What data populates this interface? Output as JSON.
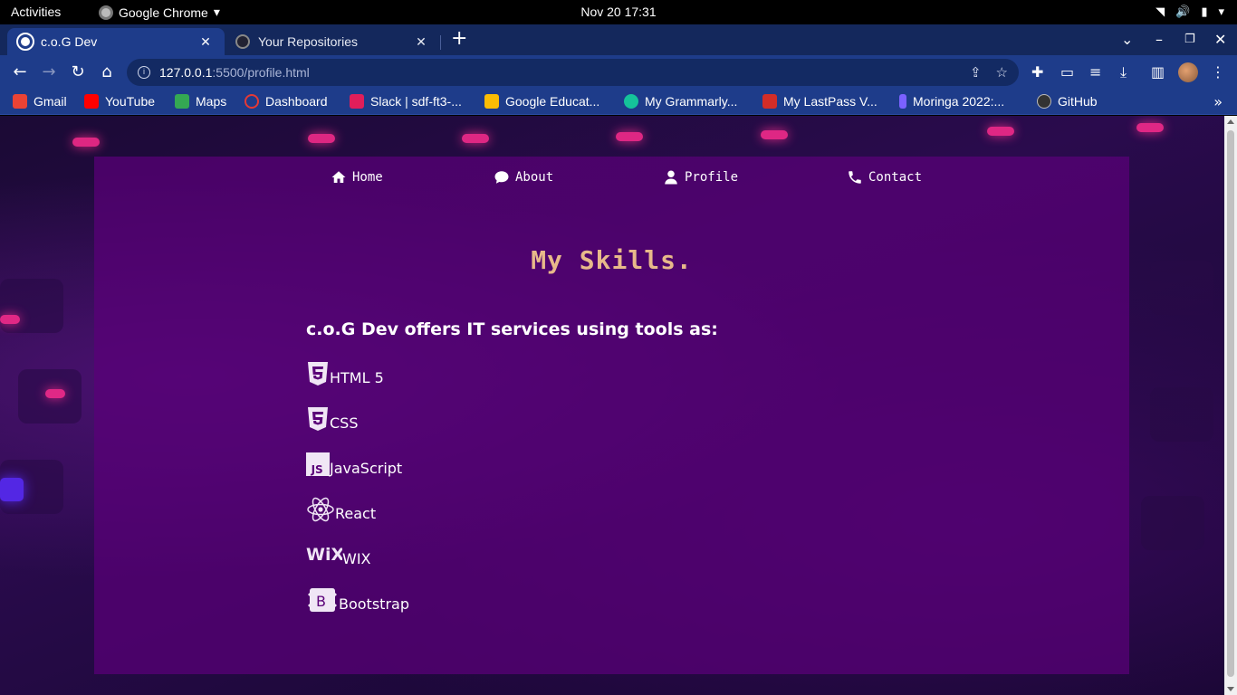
{
  "system": {
    "activities": "Activities",
    "app_name": "Google Chrome",
    "clock": "Nov 20  17:31"
  },
  "tabs": [
    {
      "title": "c.o.G Dev",
      "active": true
    },
    {
      "title": "Your Repositories",
      "active": false
    }
  ],
  "toolbar": {
    "url_host": "127.0.0.1",
    "url_path": ":5500/profile.html"
  },
  "bookmarks": [
    {
      "label": "Gmail",
      "color": "#ea4335"
    },
    {
      "label": "YouTube",
      "color": "#ff0000"
    },
    {
      "label": "Maps",
      "color": "#34a853"
    },
    {
      "label": "Dashboard",
      "color": "#e53935"
    },
    {
      "label": "Slack | sdf-ft3-...",
      "color": "#e01e5a"
    },
    {
      "label": "Google Educat...",
      "color": "#fbbc04"
    },
    {
      "label": "My Grammarly...",
      "color": "#15c39a"
    },
    {
      "label": "My LastPass V...",
      "color": "#d32d27"
    },
    {
      "label": "Moringa 2022:...",
      "color": "#7b61ff"
    },
    {
      "label": "GitHub",
      "color": "#333333"
    }
  ],
  "page": {
    "nav": [
      {
        "label": "Home",
        "icon": "home-icon"
      },
      {
        "label": "About",
        "icon": "comment-icon"
      },
      {
        "label": "Profile",
        "icon": "user-icon"
      },
      {
        "label": "Contact",
        "icon": "phone-icon"
      }
    ],
    "title": "My Skills.",
    "intro": "c.o.G Dev offers IT services using tools as:",
    "skills": [
      {
        "label": "HTML 5",
        "icon": "html5-icon"
      },
      {
        "label": "CSS",
        "icon": "css3-icon"
      },
      {
        "label": "JavaScript",
        "icon": "javascript-icon"
      },
      {
        "label": "React",
        "icon": "react-icon"
      },
      {
        "label": "WIX",
        "icon": "wix-icon"
      },
      {
        "label": "Bootstrap",
        "icon": "bootstrap-icon"
      }
    ]
  },
  "colors": {
    "title": "#e8b98a",
    "panel": "#5a0078",
    "chrome_frame": "#1e3c8a"
  }
}
